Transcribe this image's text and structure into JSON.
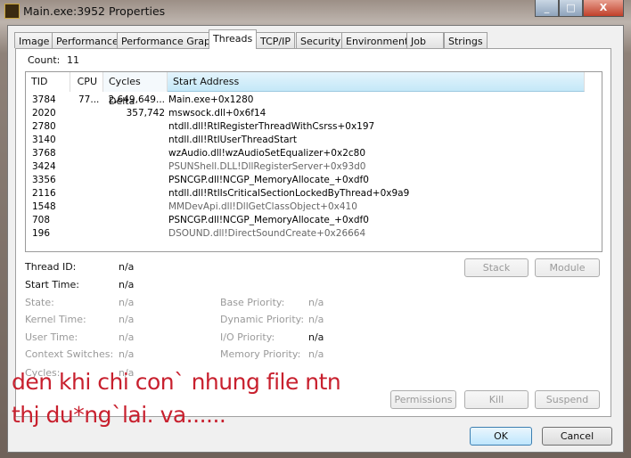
{
  "window": {
    "title": "Main.exe:3952 Properties",
    "controls": {
      "minimize": "_",
      "maximize": "□",
      "close": "X"
    }
  },
  "tabs": [
    {
      "label": "Image"
    },
    {
      "label": "Performance"
    },
    {
      "label": "Performance Graph"
    },
    {
      "label": "Threads",
      "active": true
    },
    {
      "label": "TCP/IP"
    },
    {
      "label": "Security"
    },
    {
      "label": "Environment"
    },
    {
      "label": "Job"
    },
    {
      "label": "Strings"
    }
  ],
  "threads": {
    "count_label": "Count:",
    "count": "11",
    "columns": [
      "TID",
      "CPU",
      "Cycles Delta",
      "Start Address"
    ],
    "rows": [
      {
        "tid": "3784",
        "cpu": "77...",
        "cycles": "2,649,649...",
        "start": "Main.exe+0x1280"
      },
      {
        "tid": "2020",
        "cpu": "",
        "cycles": "357,742",
        "start": "mswsock.dll+0x6f14"
      },
      {
        "tid": "2780",
        "cpu": "",
        "cycles": "",
        "start": "ntdll.dll!RtlRegisterThreadWithCsrss+0x197"
      },
      {
        "tid": "3140",
        "cpu": "",
        "cycles": "",
        "start": "ntdll.dll!RtlUserThreadStart"
      },
      {
        "tid": "3768",
        "cpu": "",
        "cycles": "",
        "start": "wzAudio.dll!wzAudioSetEqualizer+0x2c80"
      },
      {
        "tid": "3424",
        "cpu": "",
        "cycles": "",
        "start": "PSUNShell.DLL!DllRegisterServer+0x93d0"
      },
      {
        "tid": "3356",
        "cpu": "",
        "cycles": "",
        "start": "PSNCGP.dll!NCGP_MemoryAllocate_+0xdf0"
      },
      {
        "tid": "2116",
        "cpu": "",
        "cycles": "",
        "start": "ntdll.dll!RtlIsCriticalSectionLockedByThread+0x9a9"
      },
      {
        "tid": "1548",
        "cpu": "",
        "cycles": "",
        "start": "MMDevApi.dll!DllGetClassObject+0x410"
      },
      {
        "tid": "708",
        "cpu": "",
        "cycles": "",
        "start": "PSNCGP.dll!NCGP_MemoryAllocate_+0xdf0"
      },
      {
        "tid": "196",
        "cpu": "",
        "cycles": "",
        "start": "DSOUND.dll!DirectSoundCreate+0x26664"
      }
    ]
  },
  "details": {
    "thread_id": {
      "label": "Thread ID:",
      "value": "n/a"
    },
    "start_time": {
      "label": "Start Time:",
      "value": "n/a"
    },
    "state": {
      "label": "State:",
      "value": "n/a"
    },
    "kernel_time": {
      "label": "Kernel Time:",
      "value": "n/a"
    },
    "user_time": {
      "label": "User Time:",
      "value": "n/a"
    },
    "context_switches": {
      "label": "Context Switches:",
      "value": "n/a"
    },
    "cycles": {
      "label": "Cycles:",
      "value": "n/a"
    },
    "base_priority": {
      "label": "Base Priority:",
      "value": "n/a"
    },
    "dynamic_priority": {
      "label": "Dynamic Priority:",
      "value": "n/a"
    },
    "io_priority": {
      "label": "I/O Priority:",
      "value": "n/a"
    },
    "memory_priority": {
      "label": "Memory Priority:",
      "value": "n/a"
    }
  },
  "buttons": {
    "stack": "Stack",
    "module": "Module",
    "permissions": "Permissions",
    "kill": "Kill",
    "suspend": "Suspend",
    "ok": "OK",
    "cancel": "Cancel"
  },
  "annotation": {
    "line1": "den khi chi con` nhung file ntn",
    "line2": "thj du*ng`lai. va......",
    "color": "#c8202e"
  }
}
